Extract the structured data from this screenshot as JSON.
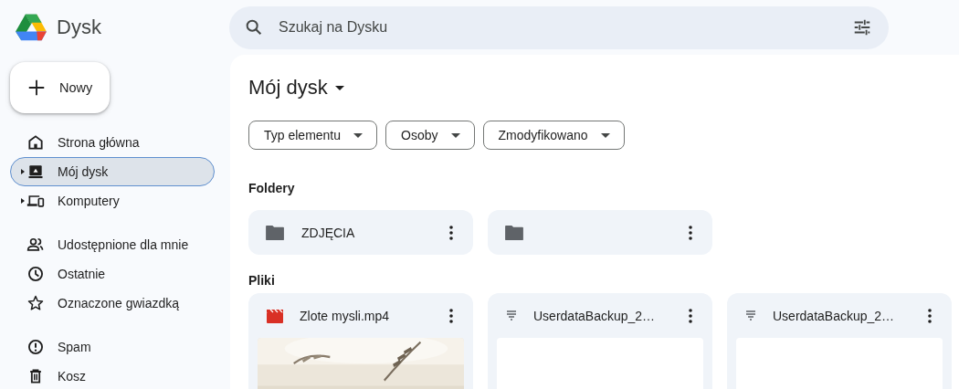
{
  "app": {
    "name": "Dysk"
  },
  "search": {
    "placeholder": "Szukaj na Dysku"
  },
  "new_button": {
    "label": "Nowy"
  },
  "sidebar": {
    "groups": [
      {
        "items": [
          {
            "label": "Strona główna",
            "selected": false,
            "expandable": false
          },
          {
            "label": "Mój dysk",
            "selected": true,
            "expandable": true
          },
          {
            "label": "Komputery",
            "selected": false,
            "expandable": true
          }
        ]
      },
      {
        "items": [
          {
            "label": "Udostępnione dla mnie",
            "selected": false,
            "expandable": false
          },
          {
            "label": "Ostatnie",
            "selected": false,
            "expandable": false
          },
          {
            "label": "Oznaczone gwiazdką",
            "selected": false,
            "expandable": false
          }
        ]
      },
      {
        "items": [
          {
            "label": "Spam",
            "selected": false,
            "expandable": false
          },
          {
            "label": "Kosz",
            "selected": false,
            "expandable": false
          }
        ]
      }
    ]
  },
  "main": {
    "title": "Mój dysk",
    "filters": [
      "Typ elementu",
      "Osoby",
      "Zmodyfikowano"
    ],
    "folders_heading": "Foldery",
    "folders": [
      {
        "name": "ZDJĘCIA",
        "kind": "folder"
      },
      {
        "kind": "folder"
      }
    ],
    "files_heading": "Pliki",
    "files": [
      {
        "name": "Zlote mysli.mp4",
        "kind": "video"
      },
      {
        "name": "UserdataBackup_2…",
        "kind": "text"
      },
      {
        "name": "UserdataBackup_2…",
        "kind": "text"
      }
    ]
  }
}
